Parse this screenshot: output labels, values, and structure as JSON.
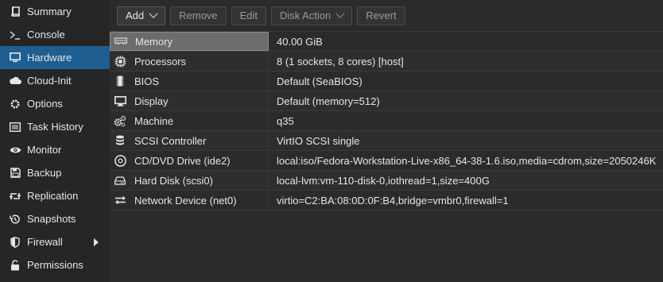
{
  "sidebar": {
    "items": [
      {
        "label": "Summary",
        "icon": "book-icon"
      },
      {
        "label": "Console",
        "icon": "terminal-icon"
      },
      {
        "label": "Hardware",
        "icon": "monitor-icon",
        "active": true
      },
      {
        "label": "Cloud-Init",
        "icon": "cloud-icon"
      },
      {
        "label": "Options",
        "icon": "gear-icon"
      },
      {
        "label": "Task History",
        "icon": "list-icon"
      },
      {
        "label": "Monitor",
        "icon": "eye-icon"
      },
      {
        "label": "Backup",
        "icon": "floppy-icon"
      },
      {
        "label": "Replication",
        "icon": "retweet-icon"
      },
      {
        "label": "Snapshots",
        "icon": "history-icon"
      },
      {
        "label": "Firewall",
        "icon": "shield-icon",
        "has_submenu": true
      },
      {
        "label": "Permissions",
        "icon": "unlock-icon"
      }
    ]
  },
  "toolbar": {
    "add": "Add",
    "remove": "Remove",
    "edit": "Edit",
    "disk_action": "Disk Action",
    "revert": "Revert"
  },
  "hardware": {
    "rows": [
      {
        "name": "Memory",
        "value": "40.00 GiB",
        "icon": "memory-icon",
        "selected": true
      },
      {
        "name": "Processors",
        "value": "8 (1 sockets, 8 cores) [host]",
        "icon": "cpu-icon"
      },
      {
        "name": "BIOS",
        "value": "Default (SeaBIOS)",
        "icon": "chip-icon"
      },
      {
        "name": "Display",
        "value": "Default (memory=512)",
        "icon": "desktop-icon"
      },
      {
        "name": "Machine",
        "value": "q35",
        "icon": "cogs-icon"
      },
      {
        "name": "SCSI Controller",
        "value": "VirtIO SCSI single",
        "icon": "database-icon"
      },
      {
        "name": "CD/DVD Drive (ide2)",
        "value": "local:iso/Fedora-Workstation-Live-x86_64-38-1.6.iso,media=cdrom,size=2050246K",
        "icon": "cdrom-icon"
      },
      {
        "name": "Hard Disk (scsi0)",
        "value": "local-lvm:vm-110-disk-0,iothread=1,size=400G",
        "icon": "hdd-icon"
      },
      {
        "name": "Network Device (net0)",
        "value": "virtio=C2:BA:08:0D:0F:B4,bridge=vmbr0,firewall=1",
        "icon": "exchange-icon"
      }
    ]
  }
}
